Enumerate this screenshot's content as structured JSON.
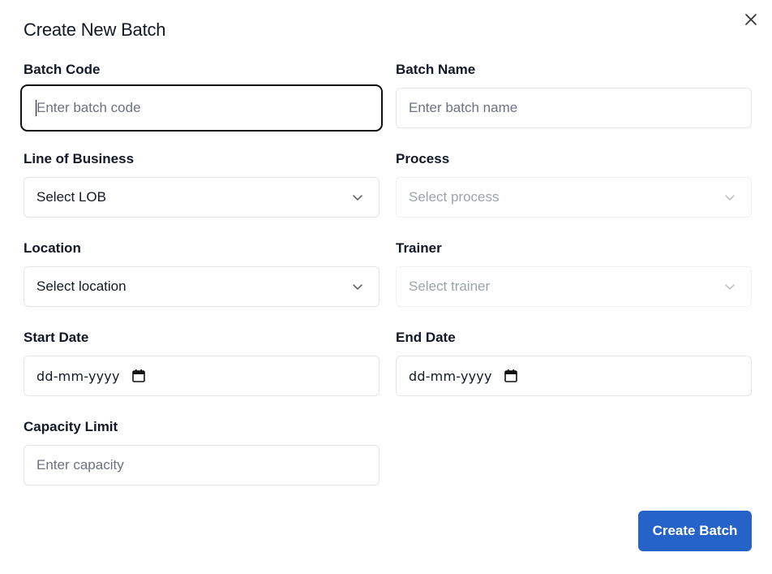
{
  "dialog": {
    "title": "Create New Batch",
    "close_icon": "close-icon"
  },
  "form": {
    "batch_code": {
      "label": "Batch Code",
      "placeholder": "Enter batch code",
      "value": ""
    },
    "batch_name": {
      "label": "Batch Name",
      "placeholder": "Enter batch name",
      "value": ""
    },
    "lob": {
      "label": "Line of Business",
      "selected": "Select LOB"
    },
    "process": {
      "label": "Process",
      "selected": "Select process",
      "disabled": true
    },
    "location": {
      "label": "Location",
      "selected": "Select location"
    },
    "trainer": {
      "label": "Trainer",
      "selected": "Select trainer",
      "disabled": true
    },
    "start_date": {
      "label": "Start Date",
      "value": "dd-mm-yyyy"
    },
    "end_date": {
      "label": "End Date",
      "value": "dd-mm-yyyy"
    },
    "capacity": {
      "label": "Capacity Limit",
      "placeholder": "Enter capacity",
      "value": ""
    }
  },
  "actions": {
    "submit_label": "Create Batch"
  },
  "colors": {
    "primary_button": "#2563c9",
    "border": "#e2e5ea",
    "focus_border": "#111111",
    "placeholder": "#6b7280",
    "disabled_text": "#9ca3af"
  }
}
